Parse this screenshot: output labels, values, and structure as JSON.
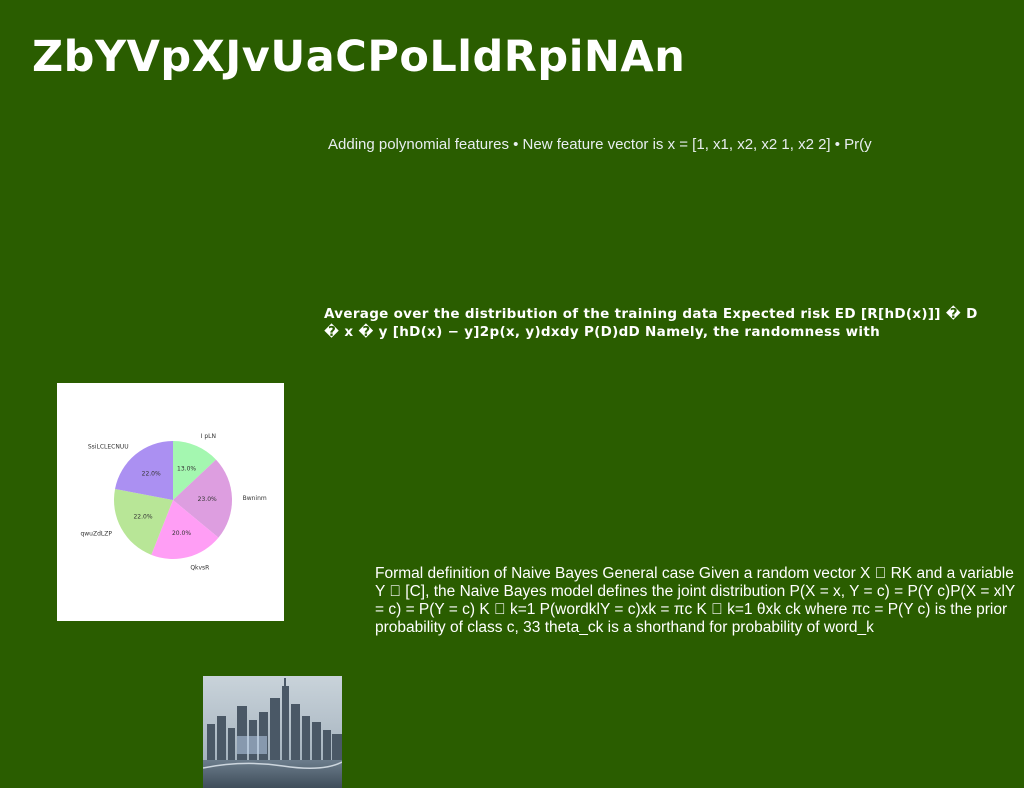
{
  "title": "ZbYVpXJvUaCPoLldRpiNAn",
  "paragraphs": {
    "p1": "Adding polynomial features • New feature vector is x = [1, x1, x2, x2 1, x2 2] • Pr(y",
    "p2": "Average over the distribution of the training data Expected risk ED [R[hD(x)]] � D � x � y [hD(x) − y]2p(x, y)dxdy P(D)dD Namely, the randomness with",
    "p3": "Formal definition of Naive Bayes General case Given a random vector X \u0000 RK and a variable Y \u0000 [C], the Naive Bayes model defines the joint distribution P(X = x, Y = c) = P(Y c)P(X = xlY = c) = P(Y = c) K \u0000 k=1 P(wordklY = c)xk = πc K \u0000 k=1 θxk ck where πc = P(Y c) is the prior probability of class c, 33 theta_ck is a shorthand for probability of word_k"
  },
  "chart_data": {
    "type": "pie",
    "title": "",
    "categories": [
      "I pLN",
      "Bwninm",
      "QkvsR",
      "qwuZdLZP",
      "SsiLCLECNUU"
    ],
    "values": [
      13.0,
      23.0,
      20.0,
      22.0,
      22.0
    ],
    "value_labels": [
      "13.0%",
      "23.0%",
      "20.0%",
      "22.0%",
      "22.0%"
    ],
    "colors": [
      "#a4f7b0",
      "#dd9ee0",
      "#ff9ef5",
      "#b8e697",
      "#ab90f2"
    ]
  },
  "photo": {
    "icon": "city-skyline-photo"
  }
}
